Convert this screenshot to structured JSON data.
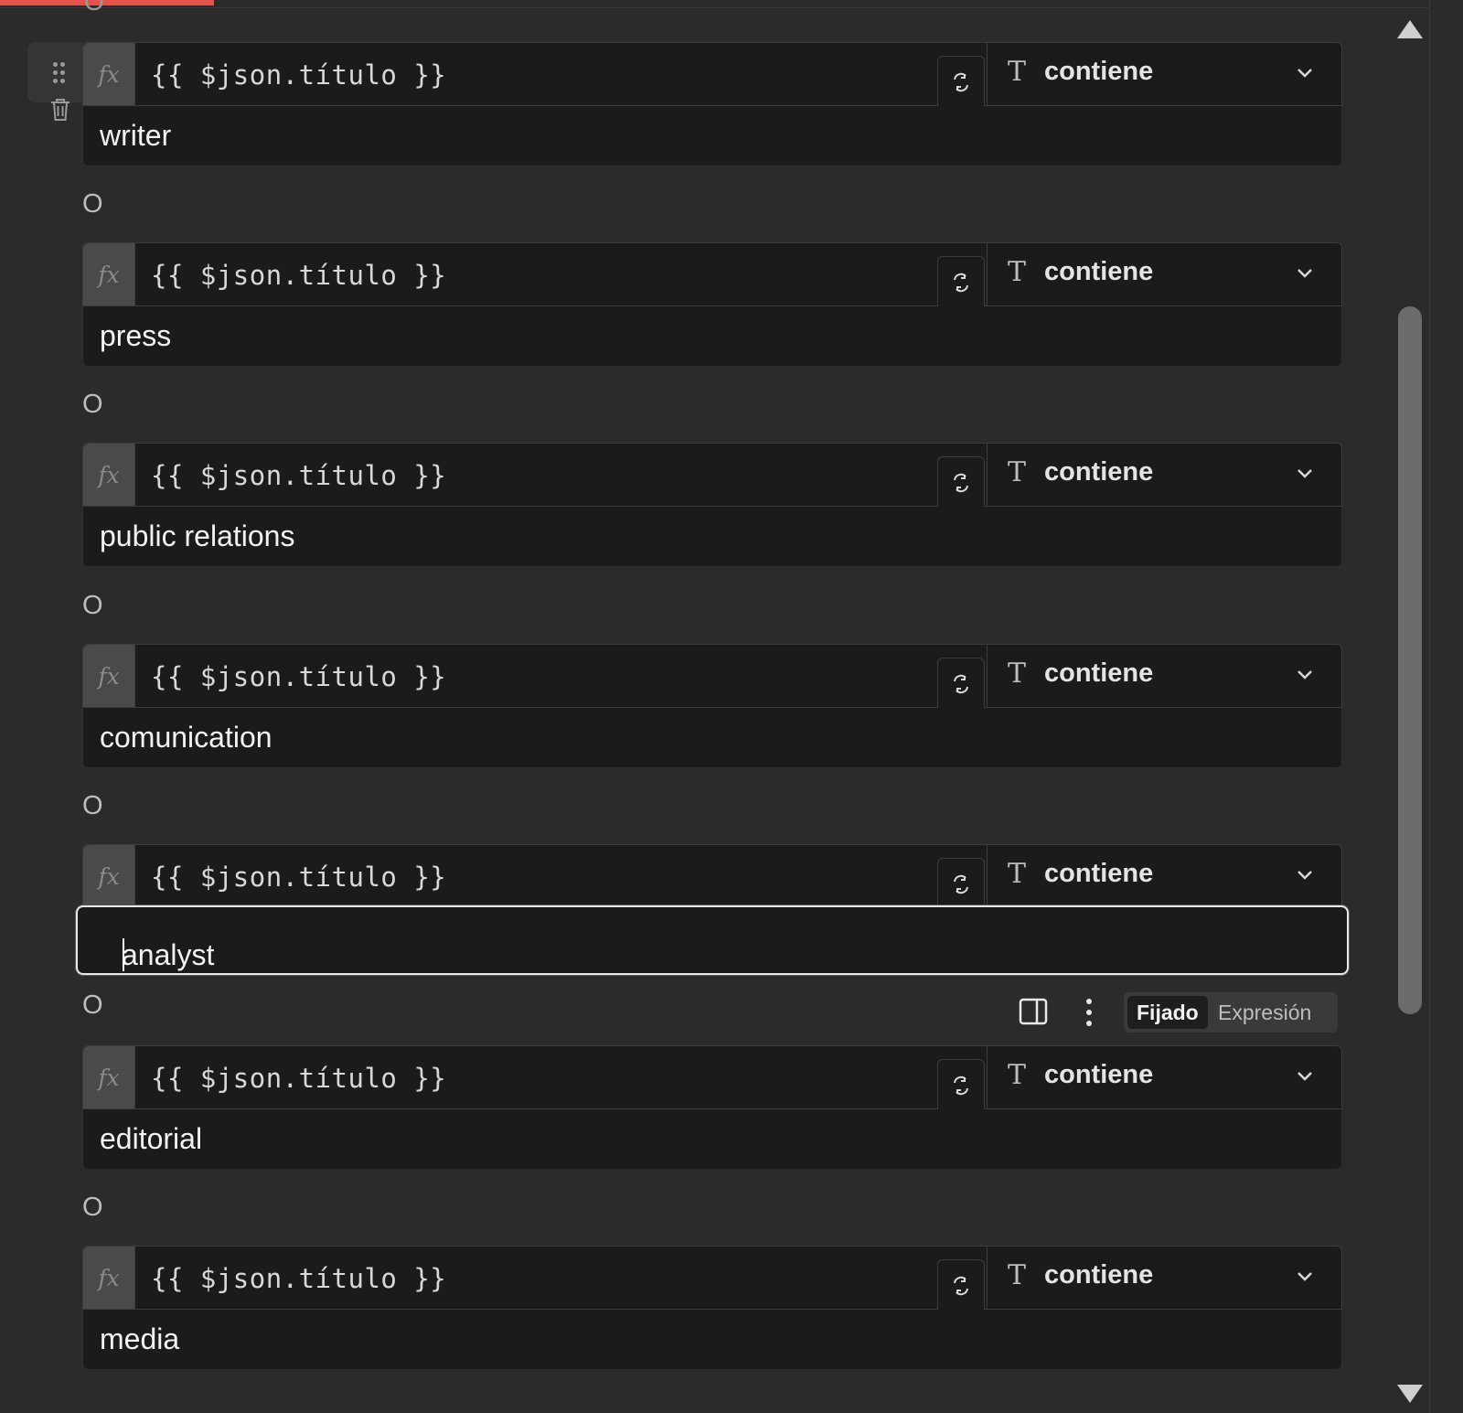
{
  "conditions": [
    {
      "expression": "{{ $json.título }}",
      "operator": "contiene",
      "value": "writer"
    },
    {
      "expression": "{{ $json.título }}",
      "operator": "contiene",
      "value": "press"
    },
    {
      "expression": "{{ $json.título }}",
      "operator": "contiene",
      "value": "public relations"
    },
    {
      "expression": "{{ $json.título }}",
      "operator": "contiene",
      "value": "comunication"
    },
    {
      "expression": "{{ $json.título }}",
      "operator": "contiene",
      "value": "analyst"
    },
    {
      "expression": "{{ $json.título }}",
      "operator": "contiene",
      "value": "editorial"
    },
    {
      "expression": "{{ $json.título }}",
      "operator": "contiene",
      "value": "media"
    }
  ],
  "combinator": "O",
  "fx_label": "fx",
  "operator_type_glyph": "T",
  "mode_toggle": {
    "fixed": "Fijado",
    "expression": "Expresión",
    "selected": "Fijado"
  },
  "accent_color": "#e4524a",
  "icons": [
    "drag-handle-icon",
    "trash-icon",
    "swap-icon",
    "chevron-down-icon",
    "split-view-icon",
    "more-vertical-icon",
    "scroll-up-icon",
    "scroll-down-icon"
  ]
}
